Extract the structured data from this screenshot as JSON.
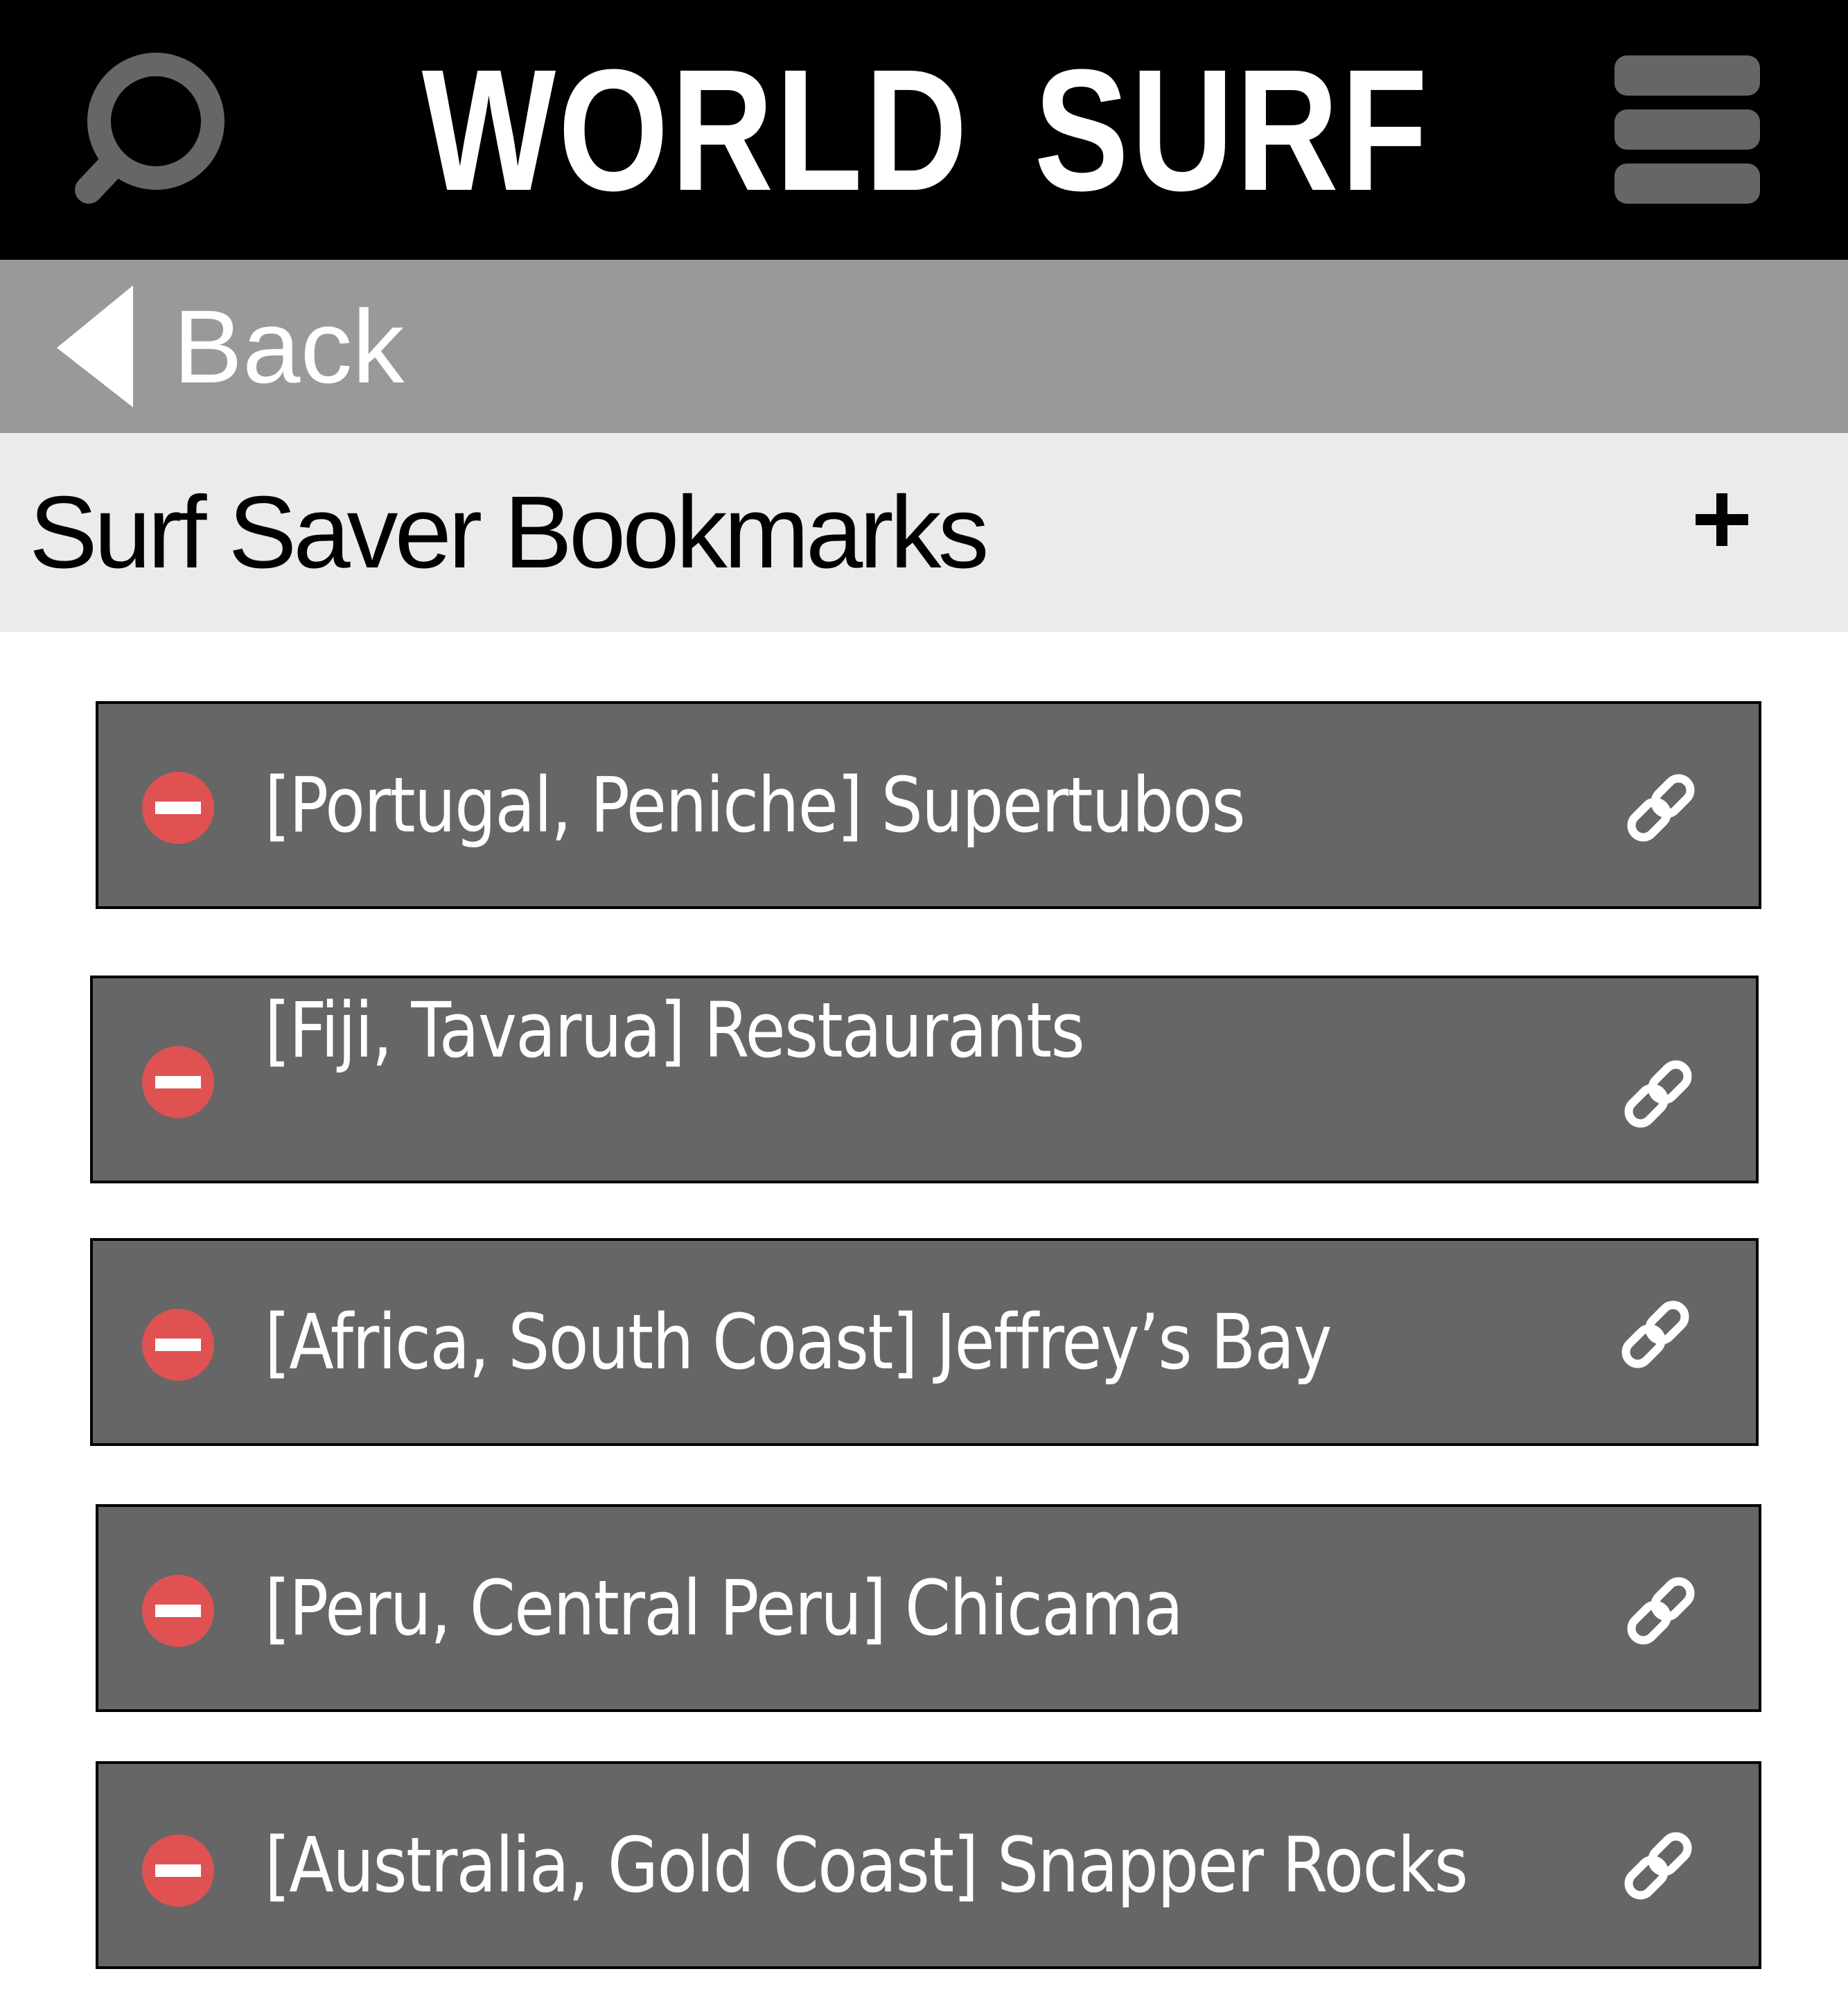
{
  "app": {
    "title": "WORLD SURF"
  },
  "header": {
    "search_icon": "search-icon",
    "menu_icon": "hamburger-menu-icon"
  },
  "nav": {
    "back_label": "Back",
    "back_icon": "back-triangle-icon"
  },
  "section": {
    "title": "Surf Saver Bookmarks",
    "add_icon": "plus-icon"
  },
  "bookmarks": [
    {
      "label": "[Portugal, Peniche] Supertubos"
    },
    {
      "label": "[Fiji, Tavarua] Restaurants"
    },
    {
      "label": "[Africa, South Coast] Jeffrey’s Bay"
    },
    {
      "label": "[Peru, Central Peru] Chicama"
    },
    {
      "label": "[Australia, Gold Coast] Snapper Rocks"
    }
  ],
  "colors": {
    "app_bar": "#000000",
    "back_bar": "#999999",
    "section_header": "#ebebeb",
    "bookmark_row": "#666666",
    "remove_badge": "#e05252",
    "icon_gray": "#666666",
    "text_light": "#ffffff"
  }
}
